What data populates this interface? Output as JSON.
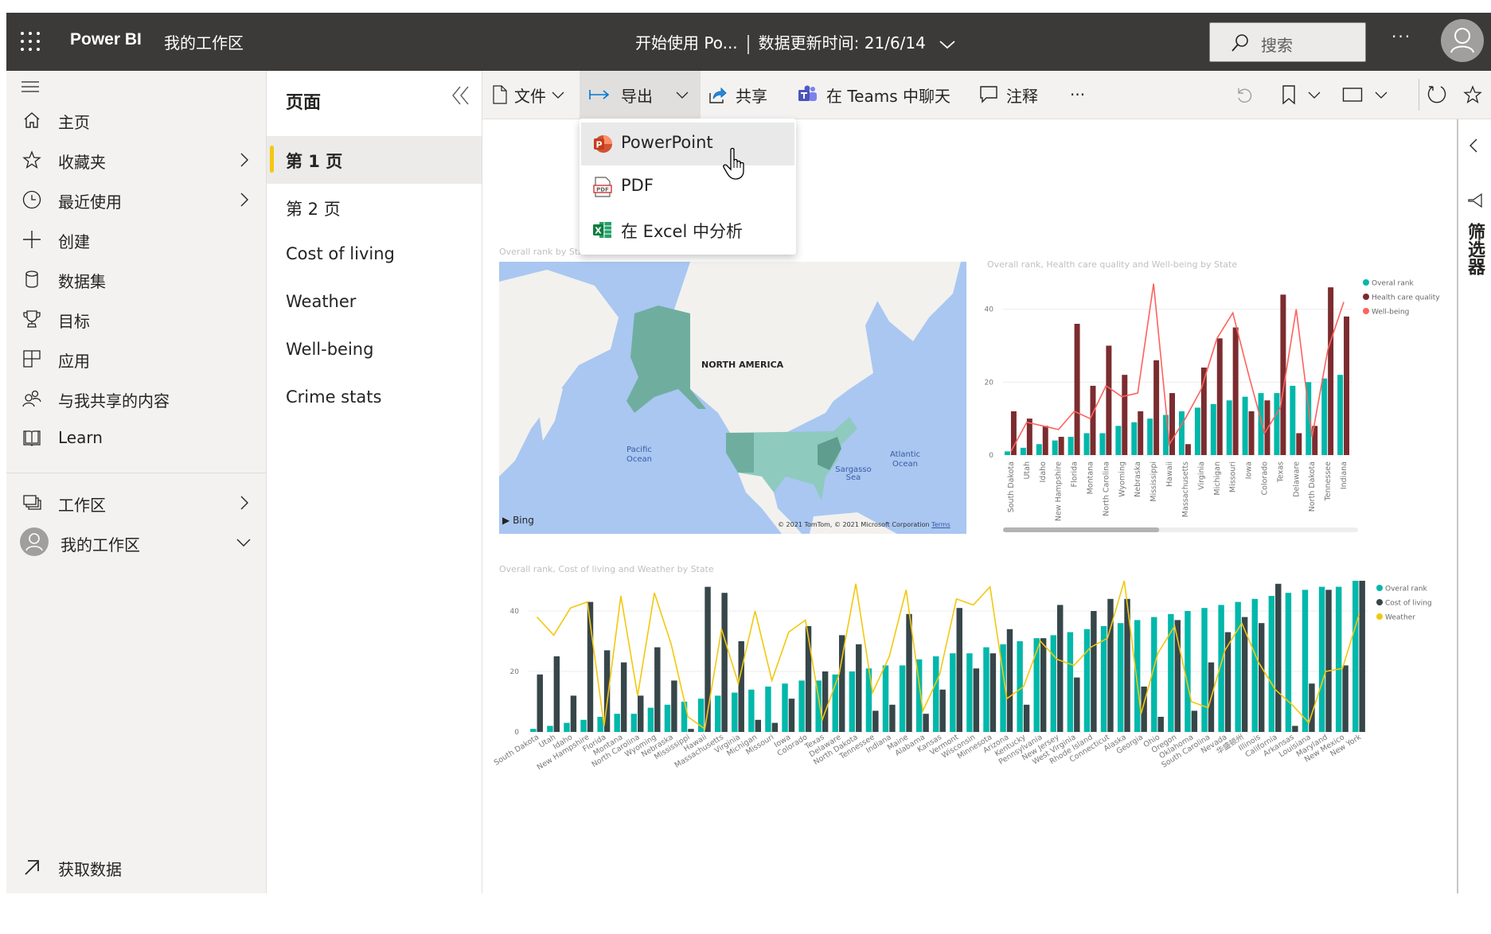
{
  "header": {
    "app_name": "Power BI",
    "workspace": "我的工作区",
    "report_title": "开始使用 Po...",
    "updated": "数据更新时间: 21/6/14",
    "search_placeholder": "搜索",
    "more": "···"
  },
  "nav": {
    "items": [
      {
        "label": "主页",
        "icon": "home-icon"
      },
      {
        "label": "收藏夹",
        "icon": "star-icon",
        "chevron": true
      },
      {
        "label": "最近使用",
        "icon": "clock-icon",
        "chevron": true
      },
      {
        "label": "创建",
        "icon": "plus-icon"
      },
      {
        "label": "数据集",
        "icon": "database-icon"
      },
      {
        "label": "目标",
        "icon": "trophy-icon"
      },
      {
        "label": "应用",
        "icon": "apps-icon"
      },
      {
        "label": "与我共享的内容",
        "icon": "shared-icon"
      },
      {
        "label": "Learn",
        "icon": "book-icon"
      }
    ],
    "workspaces": "工作区",
    "my_workspace": "我的工作区",
    "get_data": "获取数据"
  },
  "pages": {
    "title": "页面",
    "items": [
      "第 1 页",
      "第 2 页",
      "Cost of living",
      "Weather",
      "Well-being",
      "Crime stats"
    ],
    "active_index": 0
  },
  "toolbar": {
    "file": "文件",
    "export": "导出",
    "share": "共享",
    "teams": "在 Teams 中聊天",
    "comment": "注释",
    "more": "···"
  },
  "export_menu": {
    "items": [
      "PowerPoint",
      "PDF",
      "在 Excel 中分析"
    ],
    "hovered_index": 0
  },
  "filters": {
    "label": "筛选器"
  },
  "map": {
    "title": "Overall rank by State",
    "labels": {
      "continent": "NORTH AMERICA",
      "pacific": "Pacific Ocean",
      "atlantic": "Atlantic Ocean",
      "sargasso": "Sargasso Sea"
    },
    "brand": "Bing",
    "attribution": "© 2021 TomTom, © 2021 Microsoft Corporation",
    "terms": "Terms"
  },
  "colors": {
    "overall": "#01b8aa",
    "health": "#7b2c2f",
    "wellbeing": "#fd625e",
    "cost": "#374649",
    "weather": "#f2c80f",
    "accent": "#f2c811"
  },
  "chart_data": [
    {
      "type": "bar",
      "title": "Overall rank, Health care quality and Well-being by State",
      "categories": [
        "South Dakota",
        "Utah",
        "Idaho",
        "New Hampshire",
        "Florida",
        "Montana",
        "North Carolina",
        "Wyoming",
        "Nebraska",
        "Mississippi",
        "Hawaii",
        "Massachusetts",
        "Virginia",
        "Michigan",
        "Missouri",
        "Iowa",
        "Colorado",
        "Texas",
        "Delaware",
        "North Dakota",
        "Tennessee",
        "Indiana"
      ],
      "series": [
        {
          "name": "Overal rank",
          "kind": "bar",
          "values": [
            1,
            2,
            3,
            4,
            5,
            6,
            6,
            8,
            9,
            10,
            11,
            12,
            13,
            14,
            15,
            16,
            17,
            17,
            19,
            20,
            21,
            22
          ]
        },
        {
          "name": "Health care quality",
          "kind": "bar",
          "values": [
            12,
            10,
            8,
            5,
            36,
            19,
            30,
            22,
            12,
            26,
            17,
            3,
            24,
            32,
            35,
            12,
            15,
            44,
            6,
            8,
            46,
            38
          ]
        },
        {
          "name": "Well-being",
          "kind": "line",
          "values": [
            1,
            9,
            8,
            7,
            12,
            10,
            19,
            16,
            17,
            47,
            3,
            10,
            18,
            32,
            39,
            22,
            6,
            13,
            40,
            5,
            29,
            42
          ]
        }
      ],
      "yticks": [
        0,
        20,
        40
      ],
      "ylim": [
        0,
        48
      ],
      "legend": "top-right",
      "grid": true,
      "scrollbar_visible_fraction": 0.44
    },
    {
      "type": "bar",
      "title": "Overall rank, Cost of living and Weather by State",
      "categories": [
        "South Dakota",
        "Utah",
        "Idaho",
        "New Hampshire",
        "Florida",
        "Montana",
        "North Carolina",
        "Wyoming",
        "Nebraska",
        "Mississippi",
        "Hawaii",
        "Massachusetts",
        "Virginia",
        "Michigan",
        "Missouri",
        "Iowa",
        "Colorado",
        "Texas",
        "Delaware",
        "North Dakota",
        "Tennessee",
        "Indiana",
        "Maine",
        "Alabama",
        "Kansas",
        "Vermont",
        "Wisconsin",
        "Minnesota",
        "Arizona",
        "Kentucky",
        "Pennsylvania",
        "New Jersey",
        "West Virginia",
        "Rhode Island",
        "Connecticut",
        "Alaska",
        "Georgia",
        "Ohio",
        "Oregon",
        "Oklahoma",
        "South Carolina",
        "Nevada",
        "华盛顿州",
        "Illinois",
        "California",
        "Arkansas",
        "Louisiana",
        "Maryland",
        "New Mexico",
        "New York"
      ],
      "series": [
        {
          "name": "Overal rank",
          "kind": "bar",
          "values": [
            1,
            2,
            3,
            4,
            5,
            6,
            6,
            8,
            9,
            10,
            11,
            12,
            13,
            14,
            15,
            16,
            17,
            17,
            19,
            20,
            21,
            22,
            22,
            24,
            25,
            26,
            26,
            28,
            29,
            30,
            31,
            32,
            33,
            34,
            35,
            36,
            37,
            38,
            39,
            40,
            41,
            42,
            43,
            44,
            45,
            46,
            47,
            48,
            48,
            50
          ]
        },
        {
          "name": "Cost of living",
          "kind": "bar",
          "values": [
            19,
            25,
            12,
            43,
            27,
            23,
            12,
            28,
            17,
            1,
            48,
            46,
            30,
            4,
            3,
            11,
            35,
            20,
            32,
            29,
            7,
            9,
            39,
            6,
            14,
            41,
            21,
            26,
            34,
            9,
            31,
            42,
            18,
            40,
            44,
            44,
            15,
            5,
            37,
            7,
            23,
            33,
            38,
            36,
            49,
            2,
            16,
            47,
            22,
            50
          ]
        },
        {
          "name": "Weather",
          "kind": "line",
          "values": [
            38,
            32,
            41,
            43,
            2,
            45,
            12,
            46,
            29,
            5,
            1,
            34,
            16,
            40,
            17,
            33,
            37,
            4,
            19,
            49,
            13,
            25,
            47,
            7,
            19,
            44,
            42,
            48,
            11,
            15,
            30,
            24,
            22,
            28,
            31,
            50,
            6,
            26,
            35,
            10,
            8,
            27,
            36,
            23,
            14,
            9,
            3,
            20,
            21,
            39
          ]
        }
      ],
      "yticks": [
        0,
        20,
        40
      ],
      "ylim": [
        0,
        50
      ],
      "legend": "top-right",
      "grid": true
    }
  ]
}
